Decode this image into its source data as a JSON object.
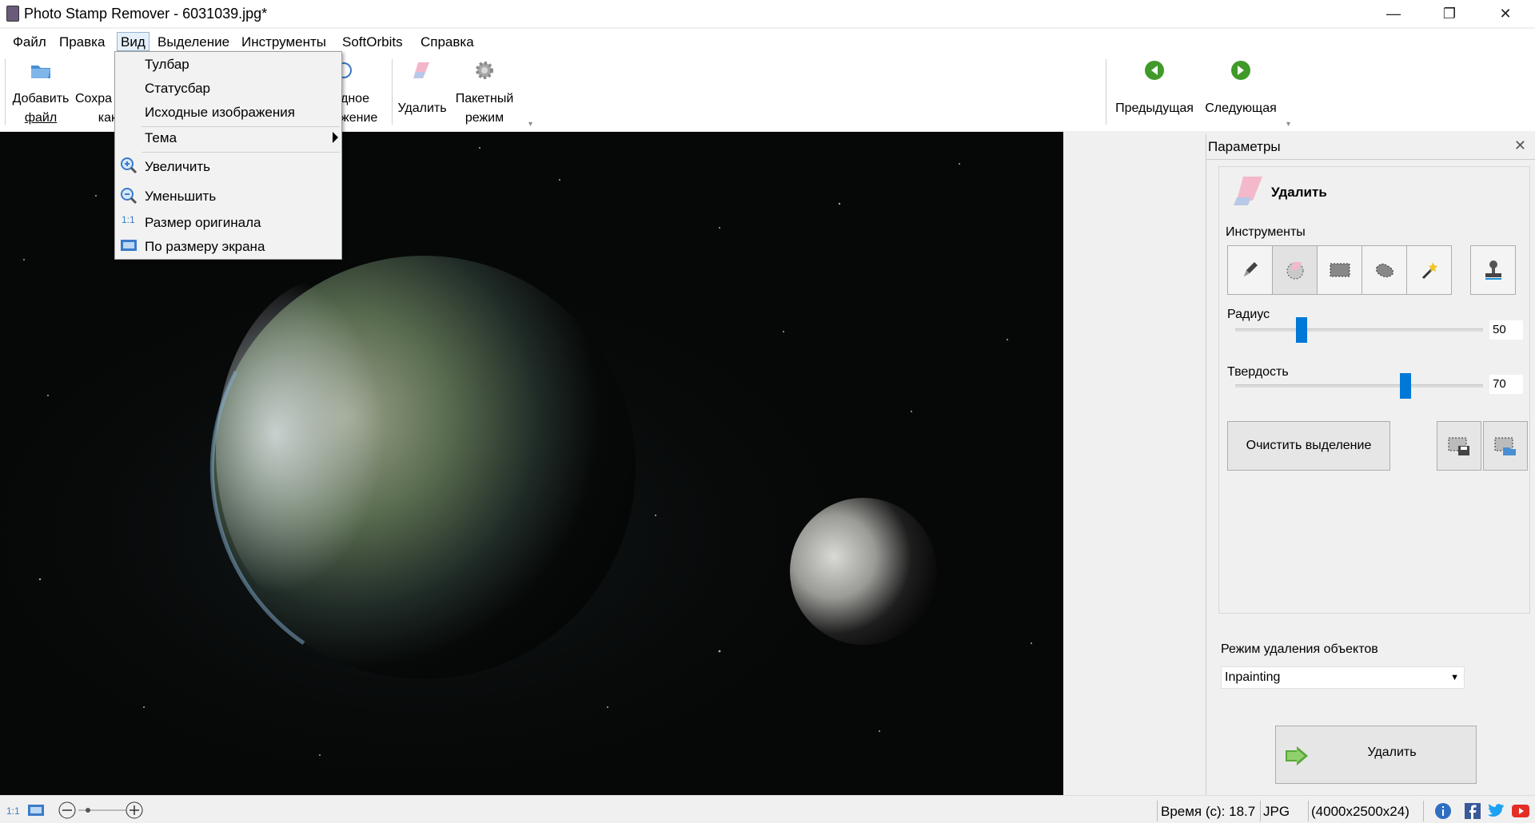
{
  "window": {
    "title": "Photo Stamp Remover - 6031039.jpg*",
    "minimize": "—",
    "restore": "❐",
    "close": "✕"
  },
  "menubar": {
    "items": [
      "Файл",
      "Правка",
      "Вид",
      "Выделение",
      "Инструменты",
      "SoftOrbits",
      "Справка"
    ]
  },
  "toolbar": {
    "add_file_l1": "Добавить",
    "add_file_l2": "файл",
    "save_l1": "Сохра",
    "save_l2": "как",
    "orig_l1": "дное",
    "orig_l2": "жение",
    "delete": "Удалить",
    "batch_l1": "Пакетный",
    "batch_l2": "режим",
    "prev": "Предыдущая",
    "next": "Следующая",
    "overflow": "▾"
  },
  "view_menu": {
    "toolbar": "Тулбар",
    "statusbar": "Статусбар",
    "source_images": "Исходные изображения",
    "theme": "Тема",
    "zoom_in": "Увеличить",
    "zoom_out": "Уменьшить",
    "original_size": "Размер оригинала",
    "fit_screen": "По размеру экрана",
    "original_size_icon_label": "1:1"
  },
  "panel": {
    "title": "Параметры",
    "close": "✕",
    "section_title": "Удалить",
    "tools_label": "Инструменты",
    "radius_label": "Радиус",
    "radius_value": "50",
    "hardness_label": "Твердость",
    "hardness_value": "70",
    "clear_selection": "Очистить выделение",
    "mode_label": "Режим удаления объектов",
    "mode_value": "Inpainting",
    "delete_button": "Удалить"
  },
  "statusbar": {
    "ratio": "1:1",
    "time": "Время (с): 18.7",
    "format": "JPG",
    "dimensions": "(4000x2500x24)"
  },
  "icons": {
    "app": "app-icon",
    "open": "folder-icon",
    "save": "floppy-icon",
    "eraser": "eraser-icon",
    "gear": "gear-icon",
    "prev": "green-arrow-left-icon",
    "next": "green-arrow-right-icon",
    "pencil": "pencil-icon",
    "lasso": "lasso-icon",
    "rect": "rect-select-icon",
    "magic": "magic-wand-icon",
    "stamp": "stamp-icon",
    "info": "info-icon",
    "facebook": "facebook-icon",
    "twitter": "twitter-icon",
    "youtube": "youtube-icon"
  },
  "colors": {
    "accent": "#0078d7",
    "canvas_bg": "#060707",
    "arrow_green": "#4caf2f"
  }
}
